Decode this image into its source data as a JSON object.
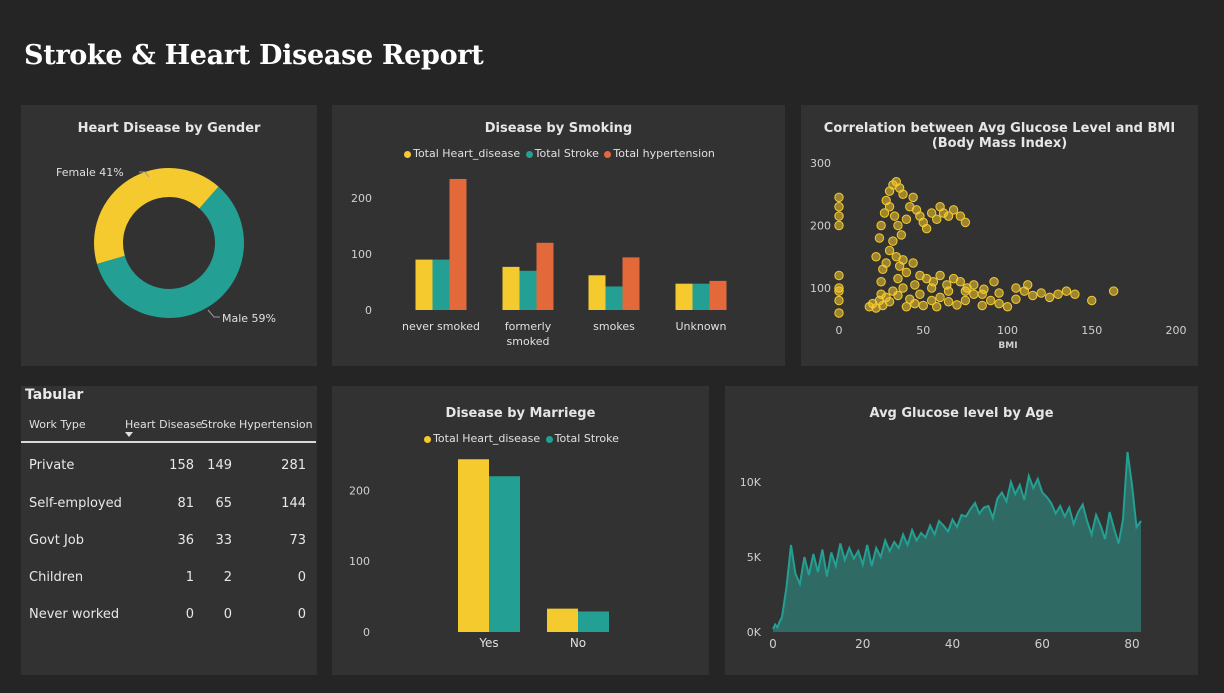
{
  "report_title": "Stroke & Heart Disease Report",
  "colors": {
    "yellow": "#f5ca2f",
    "teal": "#23a093",
    "orange": "#e3693a",
    "area": "#2f6b64"
  },
  "gender": {
    "title": "Heart Disease by Gender",
    "female_label": "Female 41%",
    "male_label": "Male 59%",
    "chart_data": {
      "type": "pie",
      "categories": [
        "Female",
        "Male"
      ],
      "values": [
        41,
        59
      ]
    }
  },
  "smoking": {
    "title": "Disease by Smoking",
    "legend": [
      "Total Heart_disease",
      "Total Stroke",
      "Total hypertension"
    ],
    "yticks": [
      "0",
      "100",
      "200"
    ],
    "xlabels": [
      [
        "never smoked"
      ],
      [
        "formerly",
        "smoked"
      ],
      [
        "smokes"
      ],
      [
        "Unknown"
      ]
    ],
    "chart_data": {
      "type": "bar",
      "categories": [
        "never smoked",
        "formerly smoked",
        "smokes",
        "Unknown"
      ],
      "series": [
        {
          "name": "Total Heart_disease",
          "values": [
            90,
            77,
            62,
            47
          ]
        },
        {
          "name": "Total Stroke",
          "values": [
            90,
            70,
            42,
            47
          ]
        },
        {
          "name": "Total hypertension",
          "values": [
            234,
            120,
            94,
            52
          ]
        }
      ],
      "ylim": [
        0,
        250
      ]
    }
  },
  "scatter": {
    "title": "Correlation between Avg Glucose Level and BMI (Body Mass Index)",
    "xlabel": "BMI",
    "yticks": [
      "100",
      "200",
      "300"
    ],
    "xticks": [
      "0",
      "50",
      "100",
      "150",
      "200"
    ],
    "chart_data": {
      "type": "scatter",
      "xlabel": "BMI",
      "xlim": [
        0,
        200
      ],
      "ylim": [
        55,
        300
      ],
      "points": [
        [
          0,
          60
        ],
        [
          0,
          80
        ],
        [
          0,
          100
        ],
        [
          0,
          120
        ],
        [
          0,
          200
        ],
        [
          0,
          230
        ],
        [
          0,
          215
        ],
        [
          0,
          245
        ],
        [
          0,
          95
        ],
        [
          18,
          70
        ],
        [
          20,
          75
        ],
        [
          22,
          68
        ],
        [
          24,
          80
        ],
        [
          25,
          90
        ],
        [
          26,
          72
        ],
        [
          28,
          85
        ],
        [
          30,
          78
        ],
        [
          32,
          95
        ],
        [
          35,
          88
        ],
        [
          38,
          100
        ],
        [
          40,
          70
        ],
        [
          42,
          82
        ],
        [
          45,
          75
        ],
        [
          48,
          90
        ],
        [
          50,
          72
        ],
        [
          55,
          80
        ],
        [
          58,
          70
        ],
        [
          60,
          85
        ],
        [
          65,
          78
        ],
        [
          70,
          73
        ],
        [
          75,
          80
        ],
        [
          80,
          90
        ],
        [
          85,
          72
        ],
        [
          90,
          80
        ],
        [
          95,
          75
        ],
        [
          100,
          70
        ],
        [
          105,
          82
        ],
        [
          110,
          95
        ],
        [
          115,
          88
        ],
        [
          120,
          92
        ],
        [
          125,
          85
        ],
        [
          130,
          90
        ],
        [
          135,
          95
        ],
        [
          140,
          90
        ],
        [
          150,
          80
        ],
        [
          163,
          95
        ],
        [
          22,
          150
        ],
        [
          24,
          180
        ],
        [
          25,
          200
        ],
        [
          27,
          220
        ],
        [
          28,
          240
        ],
        [
          30,
          255
        ],
        [
          32,
          265
        ],
        [
          34,
          270
        ],
        [
          36,
          260
        ],
        [
          38,
          250
        ],
        [
          30,
          230
        ],
        [
          33,
          215
        ],
        [
          35,
          200
        ],
        [
          37,
          185
        ],
        [
          40,
          210
        ],
        [
          42,
          230
        ],
        [
          44,
          245
        ],
        [
          46,
          225
        ],
        [
          48,
          215
        ],
        [
          50,
          205
        ],
        [
          52,
          195
        ],
        [
          55,
          220
        ],
        [
          58,
          210
        ],
        [
          60,
          230
        ],
        [
          62,
          220
        ],
        [
          65,
          215
        ],
        [
          68,
          225
        ],
        [
          72,
          215
        ],
        [
          75,
          205
        ],
        [
          26,
          130
        ],
        [
          28,
          140
        ],
        [
          30,
          160
        ],
        [
          32,
          175
        ],
        [
          34,
          150
        ],
        [
          36,
          135
        ],
        [
          38,
          145
        ],
        [
          40,
          125
        ],
        [
          44,
          140
        ],
        [
          48,
          120
        ],
        [
          52,
          115
        ],
        [
          56,
          110
        ],
        [
          60,
          120
        ],
        [
          64,
          105
        ],
        [
          68,
          115
        ],
        [
          72,
          110
        ],
        [
          76,
          100
        ],
        [
          80,
          105
        ],
        [
          86,
          98
        ],
        [
          92,
          110
        ],
        [
          25,
          110
        ],
        [
          35,
          115
        ],
        [
          45,
          105
        ],
        [
          55,
          100
        ],
        [
          65,
          95
        ],
        [
          75,
          95
        ],
        [
          85,
          90
        ],
        [
          95,
          92
        ],
        [
          105,
          100
        ],
        [
          112,
          105
        ]
      ]
    }
  },
  "table": {
    "title": "Tabular",
    "headers": [
      "Work Type",
      "Heart Disease",
      "Stroke",
      "Hypertension"
    ],
    "rows": [
      [
        "Private",
        "158",
        "149",
        "281"
      ],
      [
        "Self-employed",
        "81",
        "65",
        "144"
      ],
      [
        "Govt Job",
        "36",
        "33",
        "73"
      ],
      [
        "Children",
        "1",
        "2",
        "0"
      ],
      [
        "Never worked",
        "0",
        "0",
        "0"
      ]
    ]
  },
  "marriage": {
    "title": "Disease by Marriege",
    "legend": [
      "Total Heart_disease",
      "Total Stroke"
    ],
    "yticks": [
      "0",
      "100",
      "200"
    ],
    "chart_data": {
      "type": "bar",
      "categories": [
        "Yes",
        "No"
      ],
      "series": [
        {
          "name": "Total Heart_disease",
          "values": [
            244,
            33
          ]
        },
        {
          "name": "Total Stroke",
          "values": [
            220,
            29
          ]
        }
      ],
      "ylim": [
        0,
        250
      ]
    }
  },
  "glucose_age": {
    "title": "Avg Glucose level by Age",
    "yticks": [
      "0K",
      "5K",
      "10K"
    ],
    "xticks": [
      "0",
      "20",
      "40",
      "60",
      "80"
    ],
    "chart_data": {
      "type": "area",
      "x": [
        0,
        0.5,
        1,
        1.5,
        2,
        3,
        4,
        5,
        6,
        7,
        8,
        9,
        10,
        11,
        12,
        13,
        14,
        15,
        16,
        17,
        18,
        19,
        20,
        21,
        22,
        23,
        24,
        25,
        26,
        27,
        28,
        29,
        30,
        31,
        32,
        33,
        34,
        35,
        36,
        37,
        38,
        39,
        40,
        41,
        42,
        43,
        44,
        45,
        46,
        47,
        48,
        49,
        50,
        51,
        52,
        53,
        54,
        55,
        56,
        57,
        58,
        59,
        60,
        61,
        62,
        63,
        64,
        65,
        66,
        67,
        68,
        69,
        70,
        71,
        72,
        73,
        74,
        75,
        76,
        77,
        78,
        79,
        80,
        81,
        82
      ],
      "y": [
        200,
        500,
        300,
        700,
        1000,
        3000,
        5800,
        3900,
        3200,
        5000,
        3800,
        5200,
        4000,
        5500,
        3700,
        5300,
        4400,
        5900,
        4800,
        5600,
        4900,
        5400,
        4500,
        5800,
        4400,
        5600,
        5000,
        6100,
        5400,
        6000,
        5600,
        6500,
        5800,
        6800,
        6100,
        6600,
        6300,
        7100,
        6500,
        7400,
        7100,
        6700,
        7500,
        7000,
        7800,
        7700,
        8200,
        8600,
        7900,
        8300,
        8400,
        7600,
        8900,
        9300,
        8700,
        10000,
        9200,
        9800,
        8800,
        10400,
        9600,
        10200,
        9300,
        9000,
        8600,
        7900,
        8400,
        7700,
        8300,
        7200,
        8000,
        8500,
        7400,
        6500,
        7800,
        7100,
        6200,
        8000,
        6900,
        5900,
        7500,
        12000,
        9800,
        7000,
        7400
      ],
      "ylim": [
        0,
        13000
      ],
      "xlim": [
        0,
        82
      ]
    }
  }
}
